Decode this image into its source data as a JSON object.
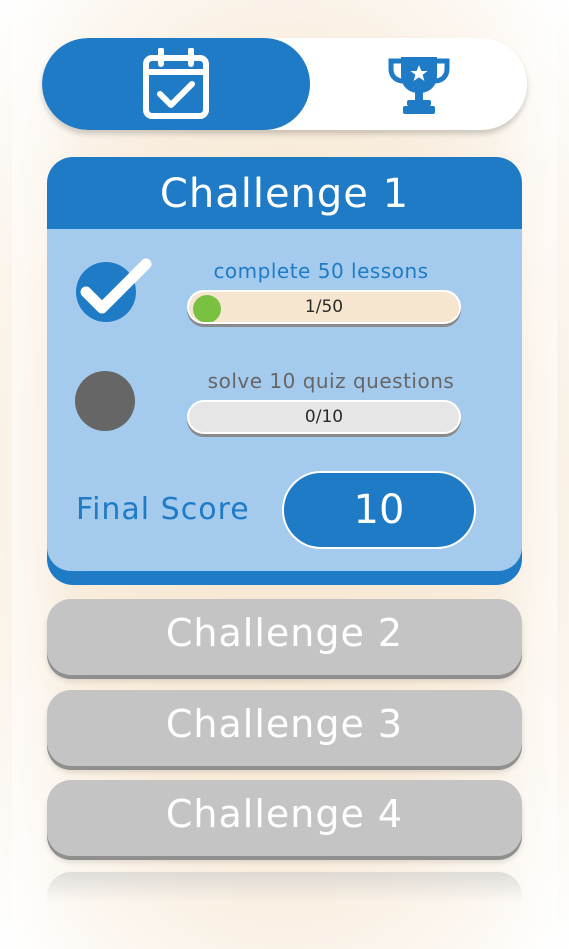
{
  "tabs": {
    "challenges_icon": "calendar-check-icon",
    "trophy_icon": "trophy-icon"
  },
  "active_challenge": {
    "title": "Challenge 1",
    "tasks": [
      {
        "label": "complete 50 lessons",
        "progress_text": "1/50",
        "progress": 0.02,
        "status": "done"
      },
      {
        "label": "solve 10 quiz questions",
        "progress_text": "0/10",
        "progress": 0,
        "status": "pending"
      }
    ],
    "final_score_label": "Final Score",
    "final_score_value": "10"
  },
  "other_challenges": [
    {
      "title": "Challenge 2"
    },
    {
      "title": "Challenge 3"
    },
    {
      "title": "Challenge 4"
    }
  ],
  "colors": {
    "primary_blue": "#1f7bc6",
    "light_blue": "#a4cbee",
    "gray_card": "#c4c4c4",
    "progress_green": "#7ac142",
    "pending_gray": "#666666"
  }
}
